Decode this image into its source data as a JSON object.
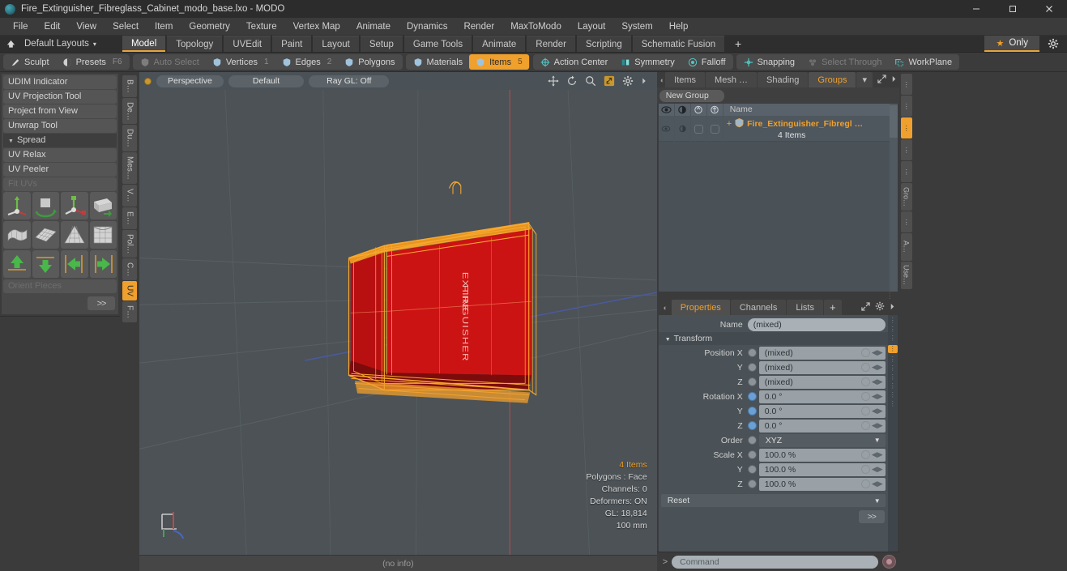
{
  "window": {
    "title": "Fire_Extinguisher_Fibreglass_Cabinet_modo_base.lxo - MODO",
    "app_logo": "modo-logo-icon",
    "minimize": "minimize-icon",
    "maximize": "maximize-icon",
    "close": "close-icon"
  },
  "menubar": {
    "items": [
      "File",
      "Edit",
      "View",
      "Select",
      "Item",
      "Geometry",
      "Texture",
      "Vertex Map",
      "Animate",
      "Dynamics",
      "Render",
      "MaxToModo",
      "Layout",
      "System",
      "Help"
    ]
  },
  "layoutbar": {
    "home_icon": "home-icon",
    "layouts_label": "Default Layouts",
    "caret": "▾",
    "tabs": [
      {
        "label": "Model",
        "active": true
      },
      {
        "label": "Topology",
        "active": false
      },
      {
        "label": "UVEdit",
        "active": false
      },
      {
        "label": "Paint",
        "active": false
      },
      {
        "label": "Layout",
        "active": false
      },
      {
        "label": "Setup",
        "active": false
      },
      {
        "label": "Game Tools",
        "active": false
      },
      {
        "label": "Animate",
        "active": false
      },
      {
        "label": "Render",
        "active": false
      },
      {
        "label": "Scripting",
        "active": false
      },
      {
        "label": "Schematic Fusion",
        "active": false
      }
    ],
    "add_tab": "+",
    "only_label": "Only",
    "only_star": "★",
    "gear": "gear-icon"
  },
  "modebar": {
    "group1": [
      {
        "label": "Sculpt",
        "icon": "brush-icon",
        "state": "normal"
      },
      {
        "label": "Presets",
        "icon": "sphere-icon",
        "state": "normal",
        "shortcut": "F6"
      }
    ],
    "group2": [
      {
        "label": "Auto Select",
        "icon": "shield-icon",
        "state": "dim"
      },
      {
        "label": "Vertices",
        "icon": "shield-icon",
        "state": "normal",
        "num": "1"
      },
      {
        "label": "Edges",
        "icon": "shield-icon",
        "state": "normal",
        "num": "2"
      },
      {
        "label": "Polygons",
        "icon": "shield-icon",
        "state": "normal",
        "num": ""
      }
    ],
    "group3": [
      {
        "label": "Materials",
        "icon": "shield-icon",
        "state": "normal"
      },
      {
        "label": "Items",
        "icon": "shield-icon",
        "state": "selected",
        "num": "5"
      }
    ],
    "group4": [
      {
        "label": "Action Center",
        "icon": "target-icon",
        "state": "normal"
      },
      {
        "label": "Symmetry",
        "icon": "symmetry-icon",
        "state": "normal"
      },
      {
        "label": "Falloff",
        "icon": "falloff-icon",
        "state": "normal"
      }
    ],
    "group5": [
      {
        "label": "Snapping",
        "icon": "snap-icon",
        "state": "normal"
      },
      {
        "label": "Select Through",
        "icon": "selectthrough-icon",
        "state": "dim"
      },
      {
        "label": "WorkPlane",
        "icon": "workplane-icon",
        "state": "normal"
      }
    ]
  },
  "left_panel": {
    "tools": [
      {
        "label": "UDIM Indicator",
        "type": "button",
        "disabled": false
      },
      {
        "label": "UV Projection Tool",
        "type": "button",
        "disabled": false
      },
      {
        "label": "Project from View",
        "type": "button",
        "disabled": false
      },
      {
        "label": "Unwrap Tool",
        "type": "button",
        "disabled": false
      },
      {
        "label": "Spread",
        "type": "section",
        "disabled": false
      },
      {
        "label": "UV Relax",
        "type": "button",
        "disabled": false
      },
      {
        "label": "UV Peeler",
        "type": "button",
        "disabled": false
      },
      {
        "label": "Fit UVs",
        "type": "button",
        "disabled": true
      }
    ],
    "icon_rows": [
      [
        "uv-move-icon",
        "uv-rotate-icon",
        "uv-scale-icon",
        "uv-fit-icon"
      ],
      [
        "uv-unwrap-icon",
        "uv-grid-icon",
        "uv-cone-icon",
        "uv-cube-icon"
      ],
      [
        "arrow-up-icon",
        "arrow-down-icon",
        "arrow-left-icon",
        "arrow-right-icon"
      ]
    ],
    "orient_label": "Orient Pieces",
    "orient_disabled": true,
    "more_label": ">>",
    "vtabs": [
      {
        "label": "B…",
        "active": false
      },
      {
        "label": "De…",
        "active": false
      },
      {
        "label": "Du…",
        "active": false
      },
      {
        "label": "Mes…",
        "active": false
      },
      {
        "label": "V…",
        "active": false
      },
      {
        "label": "E…",
        "active": false
      },
      {
        "label": "Pol…",
        "active": false
      },
      {
        "label": "C…",
        "active": false
      },
      {
        "label": "UV",
        "active": true
      },
      {
        "label": "F…",
        "active": false
      }
    ]
  },
  "viewport": {
    "indicator": "viewport-dot",
    "buttons": [
      "Perspective",
      "Default",
      "Ray GL: Off"
    ],
    "tool_icons": [
      "pan-icon",
      "rotate-icon",
      "zoom-icon",
      "fit-icon",
      "gear-icon",
      "chevron-right-icon"
    ],
    "stats": {
      "items": "4 Items",
      "polygons": "Polygons : Face",
      "channels": "Channels: 0",
      "deformers": "Deformers: ON",
      "gl": "GL: 18,814",
      "scale": "100 mm"
    },
    "model_label": "FIRE EXTINGUISHER",
    "footer": "(no info)",
    "colors": {
      "background": "#4c5256",
      "selection_wire": "#f5a623",
      "mesh_fill": "#cc1414",
      "grid": "#596065",
      "axis_x": "#b35050",
      "axis_z": "#4a5aa0"
    }
  },
  "right_panel": {
    "top_tabs": [
      {
        "label": "Items",
        "active": false
      },
      {
        "label": "Mesh …",
        "active": false
      },
      {
        "label": "Shading",
        "active": false
      },
      {
        "label": "Groups",
        "active": true
      }
    ],
    "top_tab_caret": "▾",
    "expand_icon": "expand-icon",
    "chevron_icon": "chevron-right-icon",
    "new_group_label": "New Group",
    "tree_header_icons": [
      "eye-icon",
      "render-icon",
      "lock-icon",
      "select-icon"
    ],
    "tree_name_col": "Name",
    "tree_row": {
      "plus": "+",
      "item_icon": "group-item-icon",
      "name": "Fire_Extinguisher_Fibregl …",
      "subtitle": "4 Items"
    },
    "bottom_tabs": [
      {
        "label": "Properties",
        "active": true
      },
      {
        "label": "Channels",
        "active": false
      },
      {
        "label": "Lists",
        "active": false
      },
      {
        "label": "+",
        "active": false
      }
    ],
    "properties": {
      "name_label": "Name",
      "name_value": "(mixed)",
      "transform_section": "Transform",
      "rows": [
        {
          "label": "Position X",
          "value": "(mixed)",
          "radio": "gray",
          "type": "field"
        },
        {
          "label": "Y",
          "value": "(mixed)",
          "radio": "gray",
          "type": "field"
        },
        {
          "label": "Z",
          "value": "(mixed)",
          "radio": "gray",
          "type": "field"
        },
        {
          "label": "Rotation X",
          "value": "0.0 °",
          "radio": "blue",
          "type": "field"
        },
        {
          "label": "Y",
          "value": "0.0 °",
          "radio": "blue",
          "type": "field"
        },
        {
          "label": "Z",
          "value": "0.0 °",
          "radio": "blue",
          "type": "field"
        },
        {
          "label": "Order",
          "value": "XYZ",
          "radio": "gray",
          "type": "select"
        },
        {
          "label": "Scale X",
          "value": "100.0 %",
          "radio": "gray",
          "type": "field"
        },
        {
          "label": "Y",
          "value": "100.0 %",
          "radio": "gray",
          "type": "field"
        },
        {
          "label": "Z",
          "value": "100.0 %",
          "radio": "gray",
          "type": "field"
        }
      ],
      "reset_label": "Reset",
      "more_label": ">>"
    },
    "vtabs": [
      {
        "label": "",
        "active": false
      },
      {
        "label": "",
        "active": false
      },
      {
        "label": "",
        "active": true
      },
      {
        "label": "",
        "active": false
      },
      {
        "label": "",
        "active": false
      },
      {
        "label": "Gro…",
        "active": false
      },
      {
        "label": "",
        "active": false
      },
      {
        "label": "A…",
        "active": false
      },
      {
        "label": "Use…",
        "active": false
      }
    ]
  },
  "command_bar": {
    "prompt": ">",
    "placeholder": "Command",
    "record_icon": "record-icon"
  }
}
